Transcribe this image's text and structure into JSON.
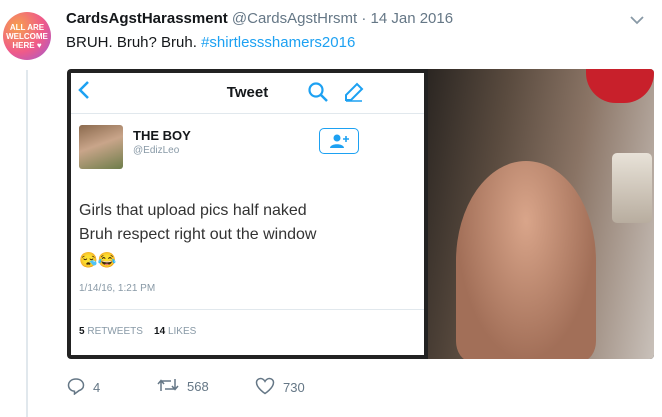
{
  "account": {
    "avatar_text": [
      "ALL ARE",
      "WELCOME",
      "HERE ♥"
    ],
    "name": "CardsAgstHarassment",
    "handle": "@CardsAgstHrsmt",
    "separator": "·",
    "date": "14 Jan 2016"
  },
  "tweet": {
    "text": "BRUH. Bruh? Bruh.",
    "hashtag": "#shirtlessshamers2016"
  },
  "screenshot": {
    "nav_title": "Tweet",
    "author_name": "THE BOY",
    "author_handle": "@EdizLeo",
    "body_lines": [
      "Girls that upload pics half naked",
      "Bruh respect right out the window"
    ],
    "emoji": "😪😂",
    "timestamp": "1/14/16, 1:21 PM",
    "retweets_count": "5",
    "retweets_label": "RETWEETS",
    "likes_count": "14",
    "likes_label": "LIKES"
  },
  "actions": {
    "replies": "4",
    "retweets": "568",
    "likes": "730"
  },
  "colors": {
    "accent": "#1da1f2",
    "meta": "#657786",
    "divider": "#e1e8ed"
  },
  "icons": {
    "menu": "chevron-down-icon",
    "reply": "reply-icon",
    "retweet": "retweet-icon",
    "like": "heart-icon"
  }
}
